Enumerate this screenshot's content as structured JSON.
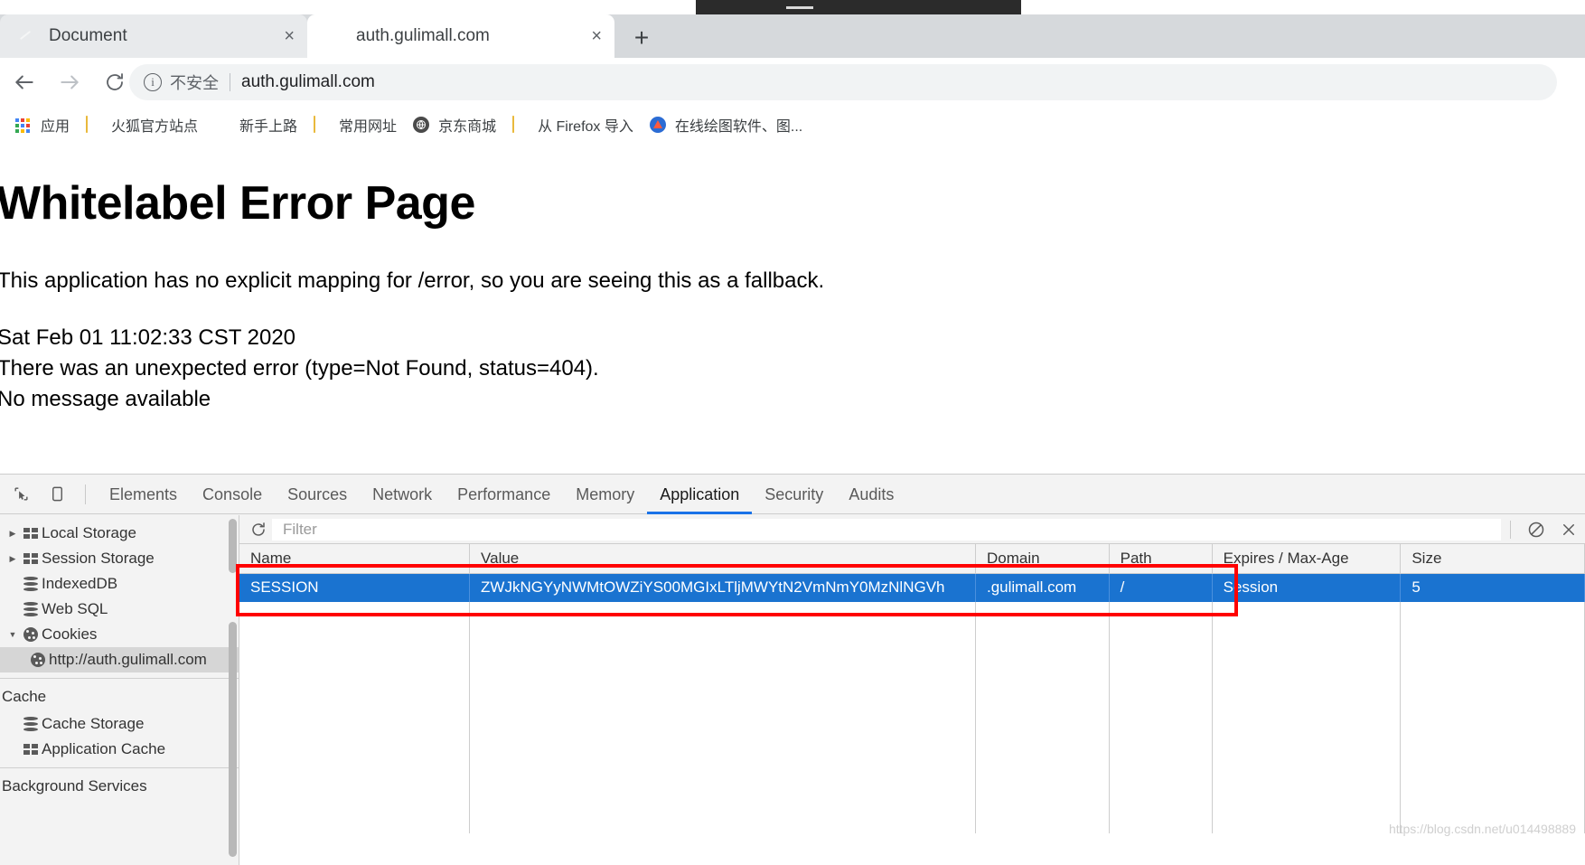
{
  "browser": {
    "tabs": [
      {
        "title": "Document",
        "favicon": "leaf-icon",
        "close": "×",
        "active": false
      },
      {
        "title": "auth.gulimall.com",
        "favicon": "leaf-icon",
        "close": "×",
        "active": true
      }
    ],
    "new_tab_label": "+",
    "omnibox": {
      "security_label": "不安全",
      "url": "auth.gulimall.com",
      "info_glyph": "i"
    },
    "bookmarks": [
      {
        "label": "应用",
        "icon": "apps-grid-icon"
      },
      {
        "label": "火狐官方站点",
        "icon": "folder-icon"
      },
      {
        "label": "新手上路",
        "icon": "firefox-icon"
      },
      {
        "label": "常用网址",
        "icon": "folder-icon"
      },
      {
        "label": "京东商城",
        "icon": "jd-globe-icon"
      },
      {
        "label": "从 Firefox 导入",
        "icon": "folder-icon"
      },
      {
        "label": "在线绘图软件、图...",
        "icon": "diagram-icon"
      }
    ]
  },
  "page": {
    "heading": "Whitelabel Error Page",
    "line1": "This application has no explicit mapping for /error, so you are seeing this as a fallback.",
    "line2": "Sat Feb 01 11:02:33 CST 2020",
    "line3": "There was an unexpected error (type=Not Found, status=404).",
    "line4": "No message available"
  },
  "devtools": {
    "tabs": [
      {
        "label": "Elements",
        "active": false
      },
      {
        "label": "Console",
        "active": false
      },
      {
        "label": "Sources",
        "active": false
      },
      {
        "label": "Network",
        "active": false
      },
      {
        "label": "Performance",
        "active": false
      },
      {
        "label": "Memory",
        "active": false
      },
      {
        "label": "Application",
        "active": true
      },
      {
        "label": "Security",
        "active": false
      },
      {
        "label": "Audits",
        "active": false
      }
    ],
    "sidebar": {
      "items": [
        {
          "label": "Local Storage",
          "icon": "grid-icon",
          "arrow": "▶",
          "indent": 0,
          "selected": false
        },
        {
          "label": "Session Storage",
          "icon": "grid-icon",
          "arrow": "▶",
          "indent": 0,
          "selected": false
        },
        {
          "label": "IndexedDB",
          "icon": "database-icon",
          "arrow": "",
          "indent": 0,
          "selected": false
        },
        {
          "label": "Web SQL",
          "icon": "database-icon",
          "arrow": "",
          "indent": 0,
          "selected": false
        },
        {
          "label": "Cookies",
          "icon": "cookie-icon",
          "arrow": "▼",
          "indent": 0,
          "selected": false
        },
        {
          "label": "http://auth.gulimall.com",
          "icon": "cookie-icon",
          "arrow": "",
          "indent": 1,
          "selected": true
        }
      ],
      "section_cache": "Cache",
      "cache_items": [
        {
          "label": "Cache Storage",
          "icon": "database-icon"
        },
        {
          "label": "Application Cache",
          "icon": "grid-icon"
        }
      ],
      "section_background": "Background Services"
    },
    "filter": {
      "placeholder": "Filter",
      "value": ""
    },
    "toolbar_icons": {
      "refresh": "refresh-icon",
      "clear": "clear-icon",
      "delete": "delete-icon",
      "inspect": "inspect-element-icon",
      "device": "device-toolbar-icon"
    },
    "cookie_table": {
      "columns": [
        "Name",
        "Value",
        "Domain",
        "Path",
        "Expires / Max-Age",
        "Size"
      ],
      "rows": [
        {
          "Name": "SESSION",
          "Value": "ZWJkNGYyNWMtOWZiYS00MGIxLTljMWYtN2VmNmY0MzNlNGVh",
          "Domain": ".gulimall.com",
          "Path": "/",
          "Expires / Max-Age": "Session",
          "Size": "5",
          "selected": true
        }
      ]
    }
  },
  "annotation": {
    "highlight_color": "#ff0000"
  },
  "watermark": "https://blog.csdn.net/u014498889"
}
